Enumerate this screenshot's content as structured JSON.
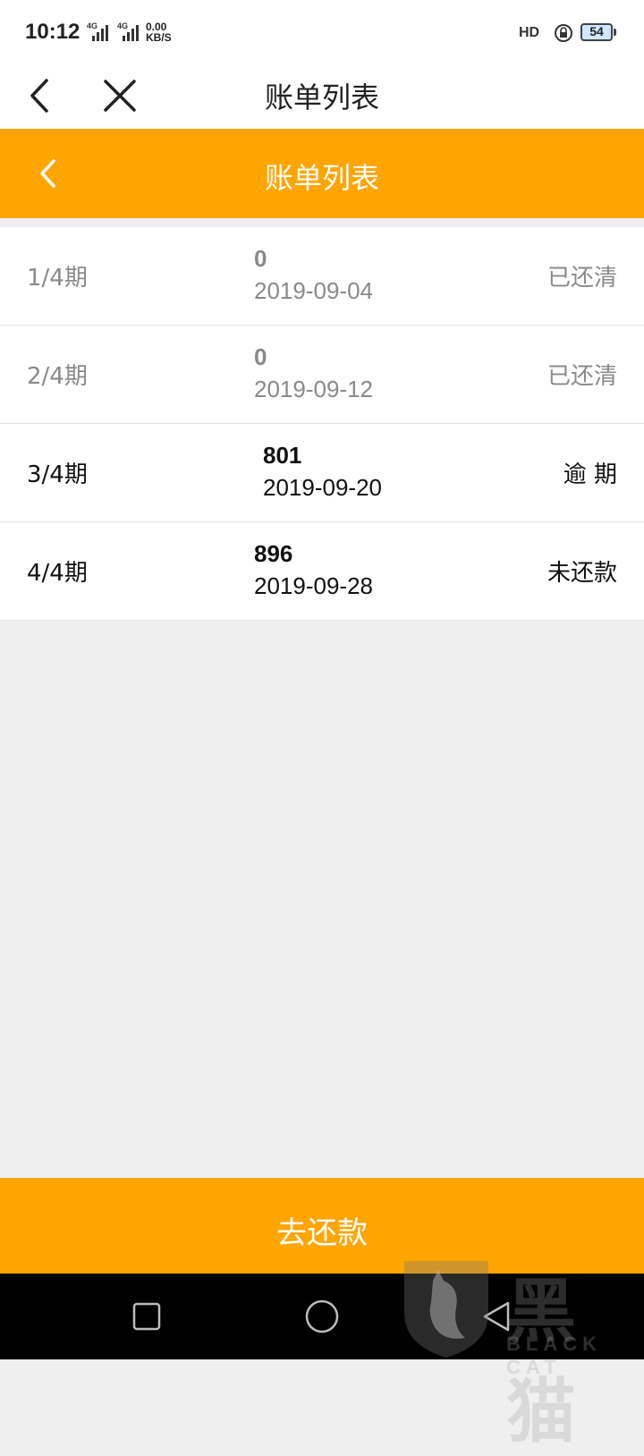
{
  "status_bar": {
    "time": "10:12",
    "signal_1": "4G",
    "signal_2": "4G",
    "speed_value": "0.00",
    "speed_unit": "KB/S",
    "hd": "HD",
    "battery": "54"
  },
  "titlebar": {
    "title": "账单列表"
  },
  "header": {
    "title": "账单列表",
    "accent": "#ffa500"
  },
  "bills": [
    {
      "period": "1/4期",
      "amount": "0",
      "date": "2019-09-04",
      "status": "已还清",
      "state": "paid"
    },
    {
      "period": "2/4期",
      "amount": "0",
      "date": "2019-09-12",
      "status": "已还清",
      "state": "paid"
    },
    {
      "period": "3/4期",
      "amount": "801",
      "date": "2019-09-20",
      "status": "逾 期",
      "state": "overdue"
    },
    {
      "period": "4/4期",
      "amount": "896",
      "date": "2019-09-28",
      "status": "未还款",
      "state": "unpaid"
    }
  ],
  "pay_button": {
    "label": "去还款"
  },
  "watermark": {
    "main": "黑猫",
    "sub": "BLACK CAT"
  },
  "icons": {
    "back": "chevron-left-icon",
    "close": "close-icon",
    "nav_recent": "square-icon",
    "nav_home": "circle-icon",
    "nav_back": "triangle-back-icon"
  }
}
